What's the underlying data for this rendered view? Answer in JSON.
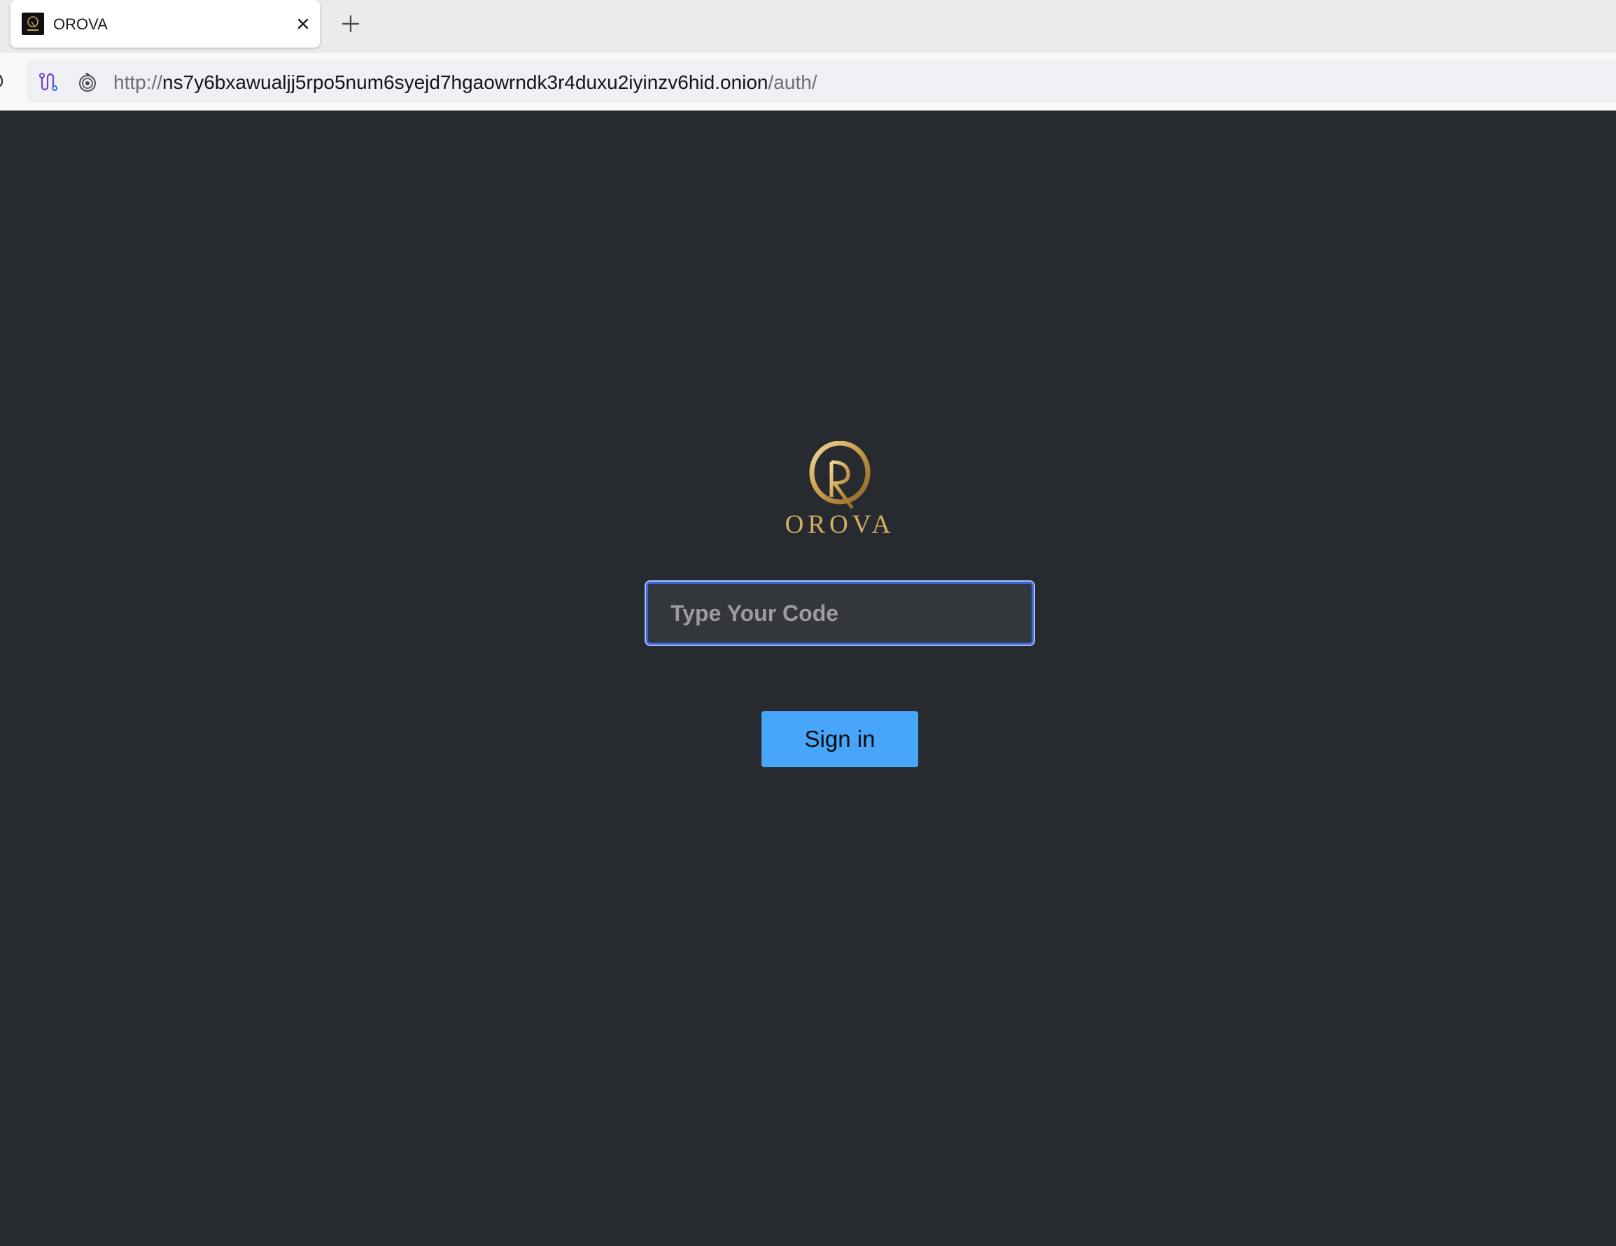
{
  "browser": {
    "tab": {
      "title": "OROVA",
      "favicon": "orova-logo-icon",
      "close_icon": "close-icon"
    },
    "new_tab_icon": "plus-icon",
    "reload_icon": "reload-icon",
    "url": {
      "scheme": "http://",
      "host": "ns7y6bxawualjj5rpo5num6syejd7hgaowrndk3r4duxu2iyinzv6hid.onion",
      "path": "/auth/"
    },
    "circuit_icon": "tor-circuit-icon",
    "onion_icon": "onion-icon"
  },
  "page": {
    "logo": {
      "wordmark": "OROVA",
      "color": "#d3ad63"
    },
    "code_input": {
      "placeholder": "Type Your Code",
      "value": ""
    },
    "signin_button": {
      "label": "Sign in",
      "color": "#47a5fa"
    },
    "background_color": "#272b2f"
  }
}
